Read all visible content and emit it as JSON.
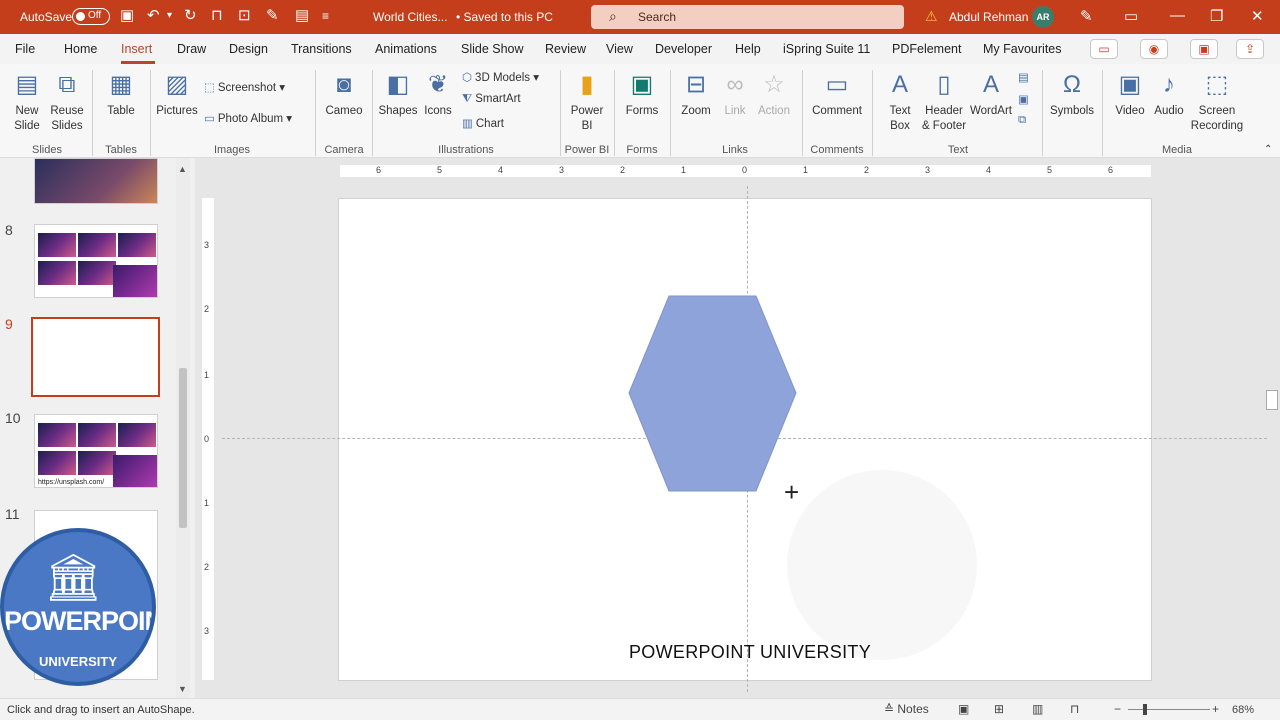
{
  "titlebar": {
    "autosave_label": "AutoSave",
    "autosave_state": "Off",
    "doc_title": "World Cities...",
    "saved_status": "• Saved to this PC",
    "search_placeholder": "Search",
    "user_name": "Abdul Rehman",
    "user_initials": "AR"
  },
  "menu": [
    "File",
    "Home",
    "Insert",
    "Draw",
    "Design",
    "Transitions",
    "Animations",
    "Slide Show",
    "Review",
    "View",
    "Developer",
    "Help",
    "iSpring Suite 11",
    "PDFelement",
    "My Favourites"
  ],
  "ribbon": {
    "new_slide": "New Slide",
    "reuse_slides": "Reuse Slides",
    "table": "Table",
    "pictures": "Pictures",
    "screenshot": "Screenshot",
    "photo_album": "Photo Album",
    "cameo": "Cameo",
    "shapes": "Shapes",
    "icons": "Icons",
    "models_3d": "3D Models",
    "smartart": "SmartArt",
    "chart": "Chart",
    "power_bi": "Power BI",
    "forms": "Forms",
    "zoom": "Zoom",
    "link": "Link",
    "action": "Action",
    "comment": "Comment",
    "text_box": "Text Box",
    "header_footer": "Header & Footer",
    "wordart": "WordArt",
    "symbols": "Symbols",
    "video": "Video",
    "audio": "Audio",
    "screen_recording": "Screen Recording",
    "groups": {
      "slides": "Slides",
      "tables": "Tables",
      "images": "Images",
      "camera": "Camera",
      "illustrations": "Illustrations",
      "power_bi": "Power BI",
      "forms": "Forms",
      "links": "Links",
      "comments": "Comments",
      "text": "Text",
      "media": "Media"
    }
  },
  "slides_panel": {
    "numbers": [
      "8",
      "9",
      "10",
      "11"
    ],
    "link_text": "https://unsplash.com/"
  },
  "logo": {
    "title": "POWERPOINT",
    "subtitle": "UNIVERSITY"
  },
  "slide": {
    "footer_text": "POWERPOINT UNIVERSITY",
    "hexagon_color": "#8ea3d9"
  },
  "ruler": {
    "h_ticks": [
      "6",
      "5",
      "4",
      "3",
      "2",
      "1",
      "0",
      "1",
      "2",
      "3",
      "4",
      "5",
      "6"
    ],
    "v_ticks": [
      "3",
      "2",
      "1",
      "0",
      "1",
      "2",
      "3"
    ]
  },
  "statusbar": {
    "message": "Click and drag to insert an AutoShape.",
    "notes": "Notes",
    "zoom": "68%"
  },
  "colors": {
    "accent": "#c43e1c",
    "ribbon_icon": "#4a6fa5"
  }
}
